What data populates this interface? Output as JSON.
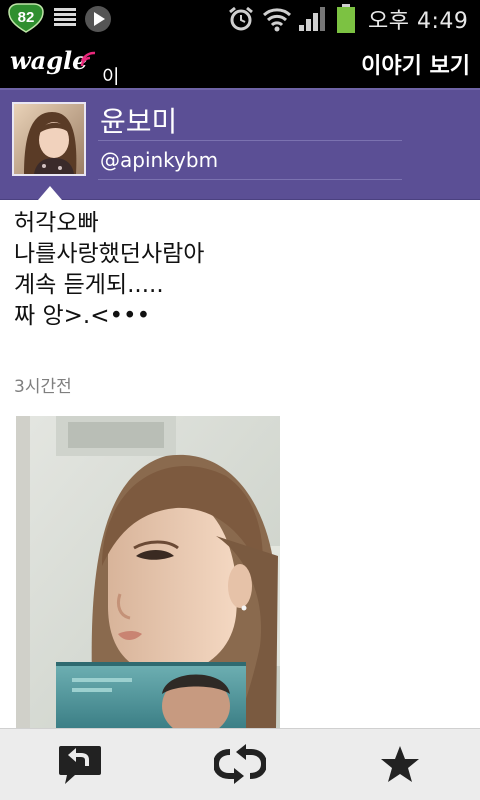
{
  "status_bar": {
    "badge_count": "82",
    "time": "오후 4:49",
    "icons": [
      "notification-badge-icon",
      "list-icon",
      "play-icon",
      "alarm-icon",
      "wifi-icon",
      "signal-icon",
      "battery-icon"
    ]
  },
  "app_bar": {
    "logo_text": "wagle",
    "logo_sub": "이야기",
    "title": "이야기 보기"
  },
  "profile": {
    "name": "윤보미",
    "handle": "@apinkybm"
  },
  "post": {
    "lines": [
      "허각오빠",
      "나를사랑했던사람아",
      "계속 듣게되.....",
      "짜 앙>.<•••"
    ],
    "time_ago": "3시간전"
  },
  "toolbar": {
    "icons": [
      "reply-icon",
      "retweet-icon",
      "star-icon"
    ]
  },
  "colors": {
    "profile_bg": "#5b4f95",
    "header_bg": "#000000",
    "battery": "#7cc242",
    "toolbar_bg": "#ececec"
  }
}
